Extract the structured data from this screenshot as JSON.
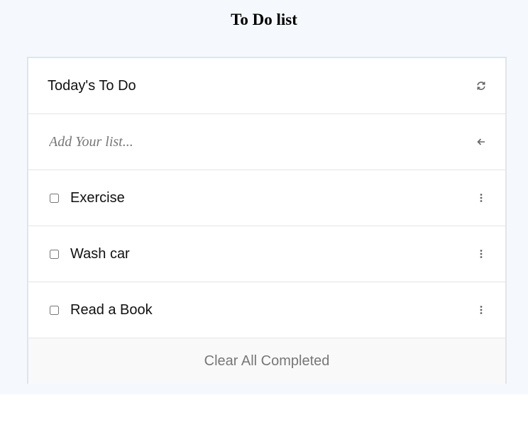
{
  "title": "To Do list",
  "card": {
    "header": {
      "title": "Today's To Do",
      "refresh_icon": "refresh-icon"
    },
    "add": {
      "placeholder": "Add Your list...",
      "submit_icon": "arrow-left-icon"
    },
    "items": [
      {
        "text": "Exercise",
        "checked": false,
        "menu_icon": "more-vertical-icon"
      },
      {
        "text": "Wash car",
        "checked": false,
        "menu_icon": "more-vertical-icon"
      },
      {
        "text": "Read a Book",
        "checked": false,
        "menu_icon": "more-vertical-icon"
      }
    ],
    "footer": {
      "clear_label": "Clear All Completed"
    }
  },
  "colors": {
    "page_background": "#f5f9fd",
    "card_border": "#dfe5ec",
    "footer_background": "#f9f9f9",
    "footer_text": "#777777"
  }
}
